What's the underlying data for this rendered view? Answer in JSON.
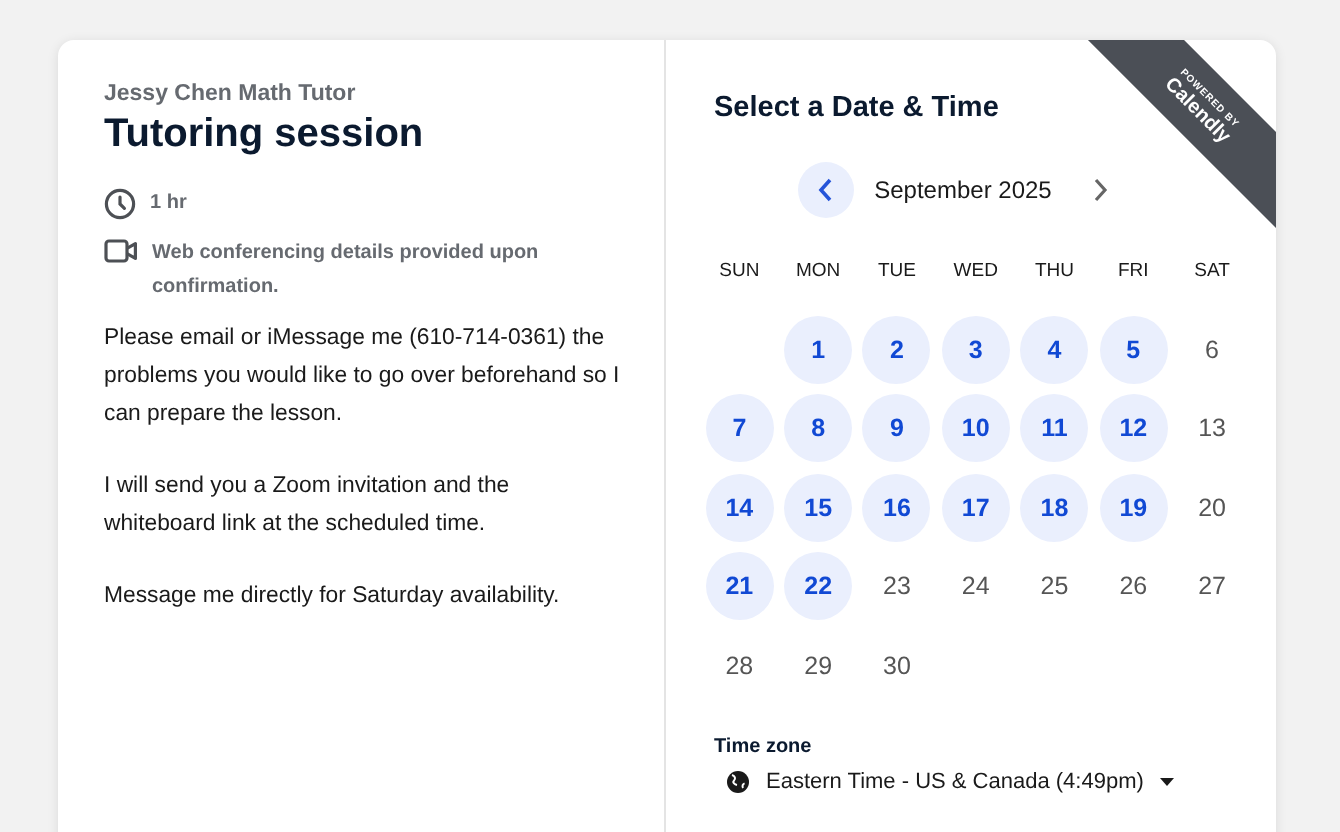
{
  "event": {
    "host": "Jessy Chen Math Tutor",
    "title": "Tutoring session",
    "details": [
      {
        "kind": "duration",
        "text": "1 hr"
      },
      {
        "kind": "video",
        "text": "Web conferencing details provided upon confirmation."
      }
    ],
    "description": [
      "Please email or iMessage me (610-714-0361) the problems you would like to go over beforehand so I can prepare the lesson.",
      "I will send you a Zoom invitation and the whiteboard link at the scheduled time.",
      "Message me directly for Saturday availability."
    ]
  },
  "ribbon": {
    "top": "POWERED BY",
    "brand": "Calendly"
  },
  "calendar": {
    "heading": "Select a Date & Time",
    "month": "September 2025",
    "prev_enabled": true,
    "next_enabled": true,
    "weekdays": [
      "SUN",
      "MON",
      "TUE",
      "WED",
      "THU",
      "FRI",
      "SAT"
    ],
    "weeks": [
      {
        "kind": "first",
        "days": [
          {
            "label": "1",
            "available": true
          },
          {
            "label": "2",
            "available": true
          },
          {
            "label": "3",
            "available": true
          },
          {
            "label": "4",
            "available": true
          },
          {
            "label": "5",
            "available": true
          },
          {
            "label": "6",
            "available": false
          }
        ]
      },
      {
        "kind": "full",
        "days": [
          {
            "label": "7",
            "available": true
          },
          {
            "label": "8",
            "available": true
          },
          {
            "label": "9",
            "available": true
          },
          {
            "label": "10",
            "available": true
          },
          {
            "label": "11",
            "available": true
          },
          {
            "label": "12",
            "available": true
          },
          {
            "label": "13",
            "available": false
          }
        ]
      },
      {
        "kind": "full",
        "days": [
          {
            "label": "14",
            "available": true
          },
          {
            "label": "15",
            "available": true
          },
          {
            "label": "16",
            "available": true
          },
          {
            "label": "17",
            "available": true
          },
          {
            "label": "18",
            "available": true
          },
          {
            "label": "19",
            "available": true
          },
          {
            "label": "20",
            "available": false
          }
        ]
      },
      {
        "kind": "full",
        "days": [
          {
            "label": "21",
            "available": true
          },
          {
            "label": "22",
            "available": true
          },
          {
            "label": "23",
            "available": false
          },
          {
            "label": "24",
            "available": false
          },
          {
            "label": "25",
            "available": false
          },
          {
            "label": "26",
            "available": false
          },
          {
            "label": "27",
            "available": false
          }
        ]
      },
      {
        "kind": "last",
        "days": [
          {
            "label": "28",
            "available": false
          },
          {
            "label": "29",
            "available": false
          },
          {
            "label": "30",
            "available": false
          }
        ]
      }
    ]
  },
  "timezone": {
    "label": "Time zone",
    "value": "Eastern Time - US & Canada (4:49pm)"
  }
}
